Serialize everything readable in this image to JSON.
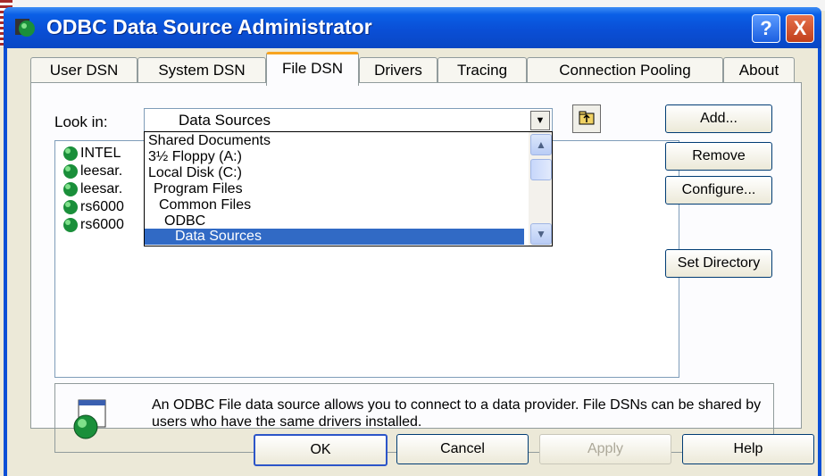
{
  "window": {
    "title": "ODBC Data Source Administrator",
    "help_button": "?",
    "close_button": "X"
  },
  "tabs": [
    "User DSN",
    "System DSN",
    "File DSN",
    "Drivers",
    "Tracing",
    "Connection Pooling",
    "About"
  ],
  "active_tab": "File DSN",
  "look_in": {
    "label": "Look in:",
    "value": "Data Sources",
    "options": [
      "Shared Documents",
      "3½ Floppy (A:)",
      "Local Disk (C:)",
      "Program Files",
      "Common Files",
      "ODBC",
      "Data Sources"
    ],
    "selected_option": "Data Sources"
  },
  "files": [
    "INTEL",
    "leesar.",
    "leesar.",
    "rs6000",
    "rs6000"
  ],
  "side_buttons": {
    "add": "Add...",
    "remove": "Remove",
    "configure": "Configure...",
    "set_directory": "Set Directory"
  },
  "info_text": "An ODBC File data source allows you to connect to a data provider.  File DSNs can be shared by users who have the same drivers installed.",
  "bottom_buttons": {
    "ok": "OK",
    "cancel": "Cancel",
    "apply": "Apply",
    "help": "Help"
  },
  "colors": {
    "title_bar": "#0a4fd6",
    "selection": "#316ac5",
    "active_tab_accent": "#f7a420"
  }
}
